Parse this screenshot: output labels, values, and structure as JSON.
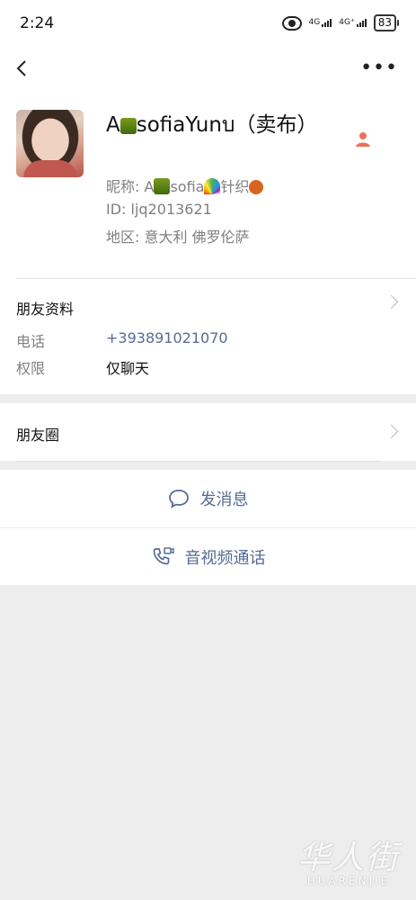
{
  "status_bar": {
    "time": "2:24",
    "net1": "4G",
    "net2": "4G⁺",
    "battery": "83"
  },
  "nav": {
    "back_icon": "chevron-left-icon",
    "more_icon": "ellipsis-icon",
    "more_label": "•••"
  },
  "profile": {
    "name_prefix": "A",
    "name_rest": "sofiaYunบ（卖布）",
    "nickname_label": "昵称:",
    "nickname_prefix": "A",
    "nickname_mid": "sofia",
    "nickname_suffix": "针织",
    "id_label": "ID:",
    "id_value": "ljq2013621",
    "region_label": "地区:",
    "region_value": "意大利  佛罗伦萨"
  },
  "friend_info": {
    "title": "朋友资料",
    "phone_label": "电话",
    "phone_value": "+393891021070",
    "permission_label": "权限",
    "permission_value": "仅聊天"
  },
  "moments": {
    "title": "朋友圈"
  },
  "actions": {
    "message_label": "发消息",
    "call_label": "音视频通话"
  },
  "watermark": {
    "cn": "华人街",
    "en": "HUARENJIE"
  },
  "colors": {
    "link": "#576b95",
    "background": "#ededed",
    "accent_person": "#e8735a"
  }
}
